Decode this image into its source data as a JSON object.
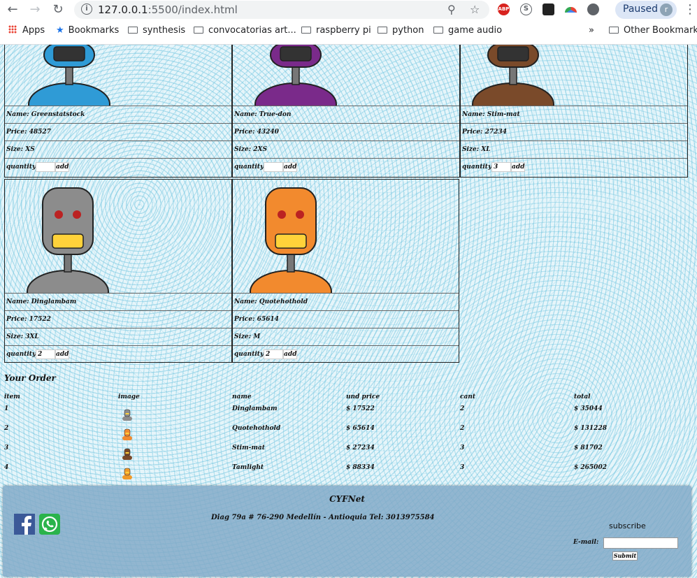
{
  "browser": {
    "url_host": "127.0.0.1",
    "url_rest": ":5500/index.html",
    "profile_status": "Paused",
    "profile_initial": "r",
    "ext_abp": "ABP",
    "bookmarks": {
      "apps": "Apps",
      "bookmarks": "Bookmarks",
      "items": [
        "synthesis",
        "convocatorias art...",
        "raspberry pi",
        "python",
        "game audio"
      ],
      "overflow": "»",
      "other": "Other Bookmarks"
    }
  },
  "products": [
    {
      "name": "Name: Greenstatstock",
      "price": "Price: 48527",
      "size": "Size: XS",
      "qty_label": "quantity",
      "qty": "",
      "add": "add",
      "color": "#2f9bd6",
      "icon": "robot-blue-icon"
    },
    {
      "name": "Name: True-don",
      "price": "Price: 43240",
      "size": "Size: 2XS",
      "qty_label": "quantity",
      "qty": "",
      "add": "add",
      "color": "#7a2a8a",
      "icon": "robot-purple-icon"
    },
    {
      "name": "Name: Stim-mat",
      "price": "Price: 27234",
      "size": "Size: XL",
      "qty_label": "quantity",
      "qty": "3",
      "add": "add",
      "color": "#7a4a2a",
      "icon": "robot-brown-icon"
    },
    {
      "name": "Name: Dinglambam",
      "price": "Price: 17522",
      "size": "Size: 3XL",
      "qty_label": "quantity",
      "qty": "2",
      "add": "add",
      "color": "#8c8c8c",
      "icon": "robot-gray-icon"
    },
    {
      "name": "Name: Quotehothold",
      "price": "Price: 65614",
      "size": "Size: M",
      "qty_label": "quantity",
      "qty": "2",
      "add": "add",
      "color": "#f28a2e",
      "icon": "robot-orange-icon"
    }
  ],
  "order": {
    "title": "Your Order",
    "headers": [
      "item",
      "image",
      "name",
      "und price",
      "cant",
      "total"
    ],
    "rows": [
      {
        "item": "1",
        "name": "Dinglambam",
        "price": "$ 17522",
        "cant": "2",
        "total": "$ 35044",
        "color": "#8c8c8c"
      },
      {
        "item": "2",
        "name": "Quotehothold",
        "price": "$ 65614",
        "cant": "2",
        "total": "$ 131228",
        "color": "#f28a2e"
      },
      {
        "item": "3",
        "name": "Stim-mat",
        "price": "$ 27234",
        "cant": "3",
        "total": "$ 81702",
        "color": "#7a4a2a"
      },
      {
        "item": "4",
        "name": "Tamlight",
        "price": "$ 88334",
        "cant": "3",
        "total": "$ 265002",
        "color": "#f09a2a"
      }
    ]
  },
  "footer": {
    "brand": "CYFNet",
    "address": "Diag 79a # 76-290 Medellín - Antioquia  Tel: 3013975584",
    "subscribe": "subscribe",
    "email_label": "E-mail:",
    "submit": "Submit"
  }
}
